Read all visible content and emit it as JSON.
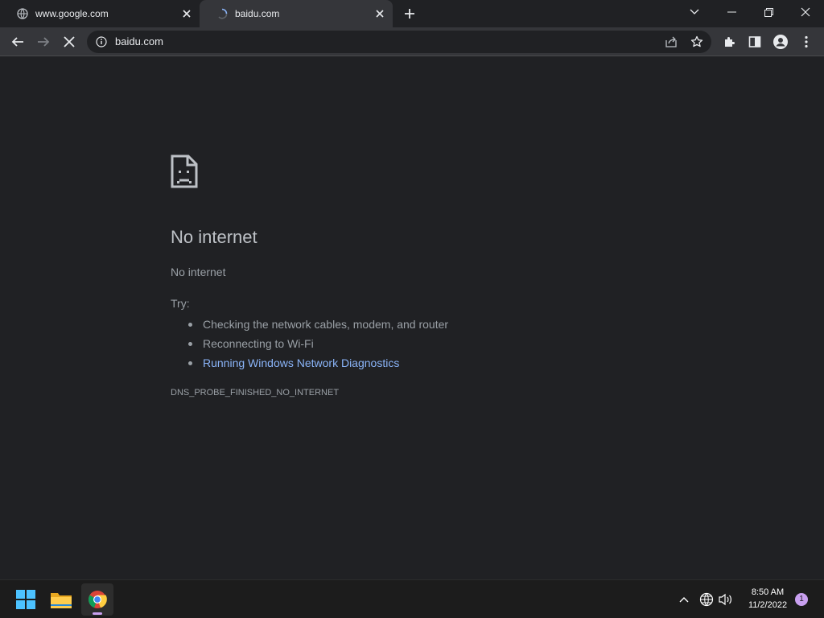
{
  "browser": {
    "tabs": [
      {
        "title": "www.google.com",
        "state": "inactive",
        "favicon": "globe-icon"
      },
      {
        "title": "baidu.com",
        "state": "loading",
        "favicon": "spinner-icon"
      }
    ],
    "address_bar": {
      "url": "baidu.com",
      "security_icon": "info-icon"
    },
    "toolbar_icons": [
      "back-icon",
      "forward-icon",
      "stop-icon",
      "share-icon",
      "star-icon",
      "extensions-icon",
      "side-panel-icon",
      "profile-icon",
      "more-icon"
    ]
  },
  "error_page": {
    "icon": "sad-page-icon",
    "heading": "No internet",
    "message": "No internet",
    "try_label": "Try:",
    "suggestions": [
      "Checking the network cables, modem, and router",
      "Reconnecting to Wi-Fi",
      "Running Windows Network Diagnostics"
    ],
    "error_code": "DNS_PROBE_FINISHED_NO_INTERNET",
    "link_color": "#8ab4f8"
  },
  "taskbar": {
    "apps": [
      "windows-start-icon",
      "file-explorer-icon",
      "chrome-icon"
    ],
    "tray_icons": [
      "chevron-up-icon",
      "network-globe-icon",
      "volume-icon"
    ],
    "time": "8:50 AM",
    "date": "11/2/2022",
    "notification_count": "1",
    "accent": "#c9a0f0"
  },
  "colors": {
    "page_bg": "#202124",
    "toolbar_bg": "#35363a",
    "heading": "#bdc1c6",
    "text": "#9aa0a6"
  }
}
